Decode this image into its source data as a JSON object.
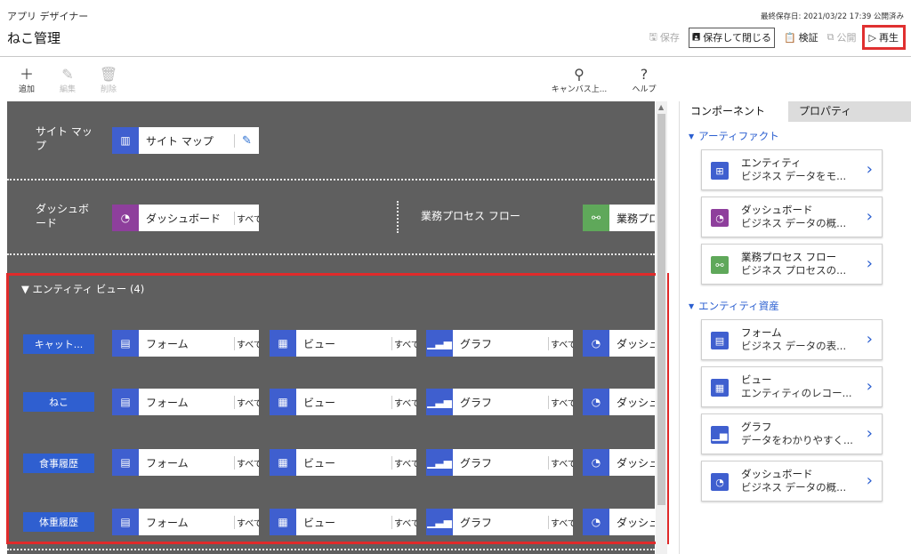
{
  "header": {
    "app_subtitle": "アプリ デザイナー",
    "app_title": "ねこ管理",
    "saved_status": "最終保存日: 2021/03/22 17:39 公開済み",
    "actions": {
      "save": "保存",
      "save_close": "保存して閉じる",
      "validate": "検証",
      "publish": "公開",
      "play": "再生"
    }
  },
  "command_bar": {
    "add": "追加",
    "edit": "編集",
    "delete": "削除",
    "canvas": "キャンバス上...",
    "help": "ヘルプ"
  },
  "canvas": {
    "sitemap_label": "サイト マップ",
    "sitemap_card": "サイト マップ",
    "dashboard_label": "ダッシュボード",
    "dashboard_card": "ダッシュボード",
    "dashboard_all": "すべて",
    "bpf_label": "業務プロセス フロー",
    "bpf_card": "業務プロ",
    "entity_view_header": "エンティティ ビュー (4)",
    "entities": [
      {
        "name": "キャット...",
        "form": "フォーム",
        "view": "ビュー",
        "chart": "グラフ",
        "dash": "ダッシュ",
        "all": "すべて"
      },
      {
        "name": "ねこ",
        "form": "フォーム",
        "view": "ビュー",
        "chart": "グラフ",
        "dash": "ダッシュ",
        "all": "すべて"
      },
      {
        "name": "食事履歴",
        "form": "フォーム",
        "view": "ビュー",
        "chart": "グラフ",
        "dash": "ダッシュ",
        "all": "すべて"
      },
      {
        "name": "体重履歴",
        "form": "フォーム",
        "view": "ビュー",
        "chart": "グラフ",
        "dash": "ダッシュ",
        "all": "すべて"
      }
    ]
  },
  "panel": {
    "tab_components": "コンポーネント",
    "tab_properties": "プロパティ",
    "group_artifacts": "アーティファクト",
    "group_entity_assets": "エンティティ資産",
    "artifacts": [
      {
        "title": "エンティティ",
        "desc": "ビジネス データをモ...",
        "icon": "entity-icon",
        "color": "#3f5fcf"
      },
      {
        "title": "ダッシュボード",
        "desc": "ビジネス データの概...",
        "icon": "dashboard-icon",
        "color": "#8e3f9c"
      },
      {
        "title": "業務プロセス フロー",
        "desc": "ビジネス プロセスの...",
        "icon": "flow-icon",
        "color": "#5fa85a"
      }
    ],
    "assets": [
      {
        "title": "フォーム",
        "desc": "ビジネス データの表...",
        "icon": "form-icon",
        "color": "#3f5fcf"
      },
      {
        "title": "ビュー",
        "desc": "エンティティのレコー...",
        "icon": "view-icon",
        "color": "#3f5fcf"
      },
      {
        "title": "グラフ",
        "desc": "データをわかりやすく...",
        "icon": "chart-icon",
        "color": "#3f5fcf"
      },
      {
        "title": "ダッシュボード",
        "desc": "ビジネス データの概...",
        "icon": "dashboard-icon",
        "color": "#3f5fcf"
      }
    ]
  }
}
